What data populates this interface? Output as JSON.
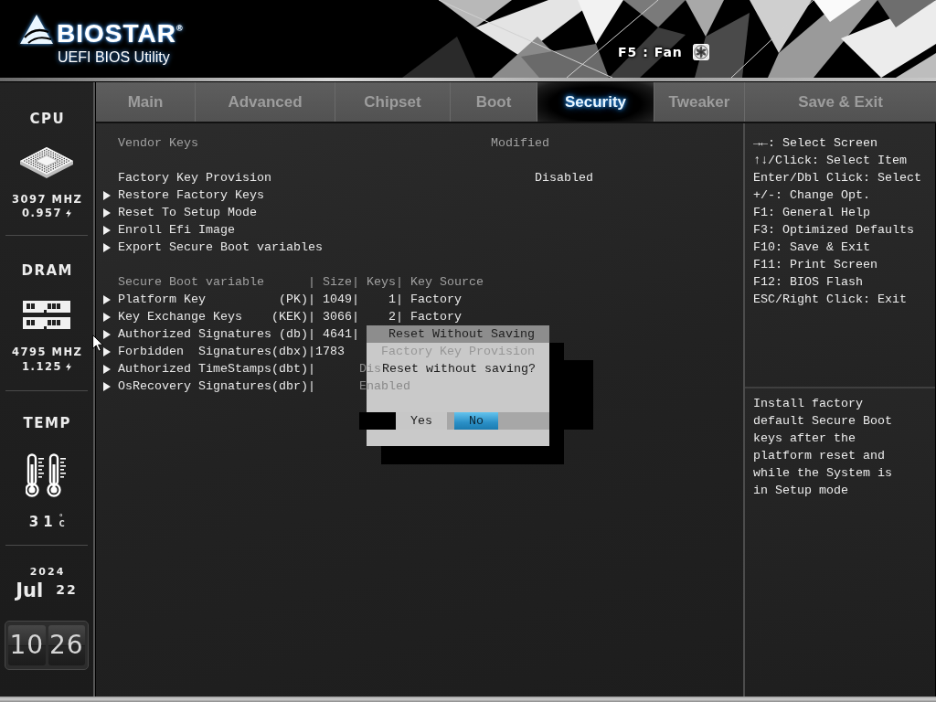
{
  "header": {
    "brand": "BIOSTAR$^{®}$",
    "subtitle": "UEFI BIOS Utility",
    "hotkey": "F5 : Fan"
  },
  "sidebar": {
    "monitors": [
      {
        "kind": "cpu",
        "label": "CPU",
        "frequency": "3097 MHZ",
        "voltage": "0.957"
      },
      {
        "kind": "dram",
        "label": "DRAM",
        "frequency": "4795 MHZ",
        "voltage": "1.125"
      },
      {
        "kind": "temp",
        "label": "TEMP",
        "value": "31",
        "unit": "°C"
      }
    ],
    "date": {
      "year": "2024",
      "month": "Jul",
      "day": "22"
    },
    "clock": {
      "hours": "10",
      "minutes": "26"
    }
  },
  "tabs": [
    {
      "label": "Main",
      "selected": false
    },
    {
      "label": "Advanced",
      "selected": false
    },
    {
      "label": "Chipset",
      "selected": false
    },
    {
      "label": "Boot",
      "selected": false
    },
    {
      "label": "Security",
      "selected": true
    },
    {
      "label": "Tweaker",
      "selected": false
    },
    {
      "label": "Save & Exit",
      "selected": false
    }
  ],
  "settings": {
    "sections": [
      {
        "items": [
          {
            "kind": "info",
            "label": "Vendor Keys",
            "value": "Modified"
          }
        ]
      },
      {
        "items": [
          {
            "kind": "option",
            "label": "Factory Key Provision",
            "value": "Disabled"
          },
          {
            "kind": "submenu",
            "label": "Restore Factory Keys"
          },
          {
            "kind": "submenu",
            "label": "Reset To Setup Mode"
          },
          {
            "kind": "submenu",
            "label": "Enroll Efi Image"
          },
          {
            "kind": "submenu",
            "label": "Export Secure Boot variables"
          }
        ]
      },
      {
        "items": [
          {
            "kind": "header",
            "label": "Secure Boot variable      | Size| Keys| Key Source"
          },
          {
            "kind": "submenu",
            "label": "Platform Key          (PK)| 1049|    1| Factory"
          },
          {
            "kind": "submenu",
            "label": "Key Exchange Keys    (KEK)| 3066|    2| Factory"
          },
          {
            "kind": "submenu",
            "label": "Authorized Signatures (db)| 4641|"
          },
          {
            "kind": "submenu",
            "label": "Forbidden  Signatures(dbx)|1783"
          },
          {
            "kind": "submenu",
            "label": "Authorized TimeStamps(dbt)|"
          },
          {
            "kind": "submenu",
            "label": "OsRecovery Signatures(dbr)|"
          }
        ]
      }
    ]
  },
  "help": {
    "keys": [
      "→←: Select Screen",
      "↑↓/Click: Select Item",
      "Enter/Dbl Click: Select",
      "+/-: Change Opt.",
      "F1: General Help",
      "F3: Optimized Defaults",
      "F10: Save & Exit",
      "F11: Print Screen",
      "F12: BIOS Flash",
      "ESC/Right Click: Exit"
    ],
    "description": "Install factory default Secure Boot keys after the platform reset and while the System is in Setup mode"
  },
  "dialog": {
    "title": "Reset Without Saving",
    "message": "Reset without saving?",
    "buttons": [
      {
        "label": "Yes",
        "selected": false
      },
      {
        "label": "No",
        "selected": true
      }
    ]
  },
  "stale_popup": {
    "title": "Factory Key Provision",
    "options": [
      "Dis",
      "Enabled"
    ]
  }
}
